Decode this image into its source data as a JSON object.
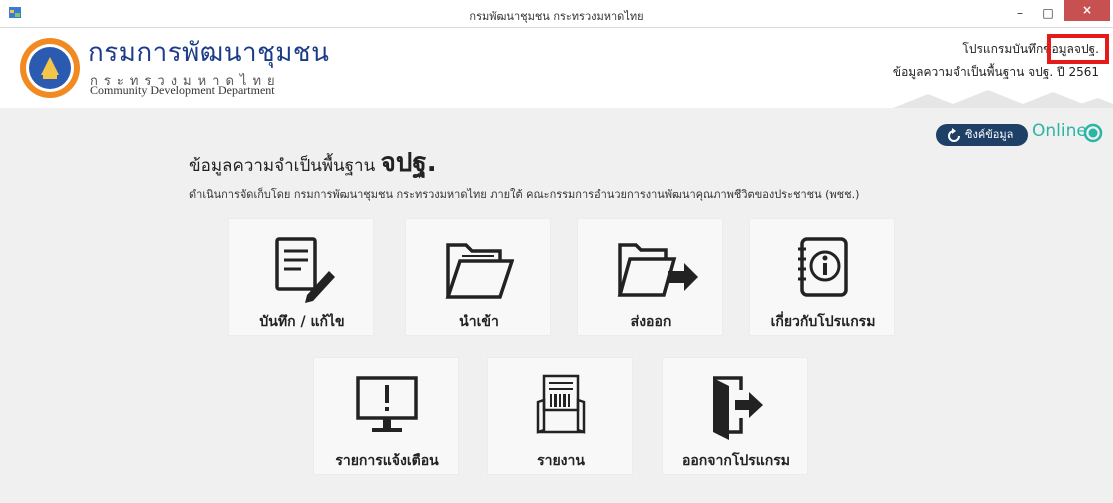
{
  "window": {
    "title": "กรมพัฒนาชุมชน กระทรวงมหาดไทย",
    "min": "–",
    "max": "□",
    "close": "×"
  },
  "header": {
    "dept_th": "กรมการพัฒนาชุมชน",
    "ministry": "กระทรวงมหาดไทย",
    "dept_en": "Community Development Department",
    "program_line1": "โปรแกรมบันทึกข้อมูลจปฐ.",
    "program_line2": "ข้อมูลความจำเป็นพื้นฐาน จปฐ. ปี 2561"
  },
  "status": {
    "sync_label": "ซิงค์ข้อมูล",
    "online": "Online",
    "online_color": "#2bb5a4"
  },
  "main": {
    "title_prefix": "ข้อมูลความจำเป็นพื้นฐาน",
    "title_bold": "จปฐ.",
    "subtitle": "ดำเนินการจัดเก็บโดย กรมการพัฒนาชุมชน กระทรวงมหาดไทย ภายใต้ คณะกรรมการอำนวยการงานพัฒนาคุณภาพชีวิตของประชาชน (พชช.)"
  },
  "tiles": [
    {
      "label": "บันทึก / แก้ไข",
      "icon": "edit-document-icon"
    },
    {
      "label": "นำเข้า",
      "icon": "folder-open-icon"
    },
    {
      "label": "ส่งออก",
      "icon": "folder-export-icon"
    },
    {
      "label": "เกี่ยวกับโปรแกรม",
      "icon": "info-notebook-icon"
    },
    {
      "label": "รายการแจ้งเตือน",
      "icon": "monitor-alert-icon"
    },
    {
      "label": "รายงาน",
      "icon": "report-print-icon"
    },
    {
      "label": "ออกจากโปรแกรม",
      "icon": "exit-door-icon"
    }
  ]
}
